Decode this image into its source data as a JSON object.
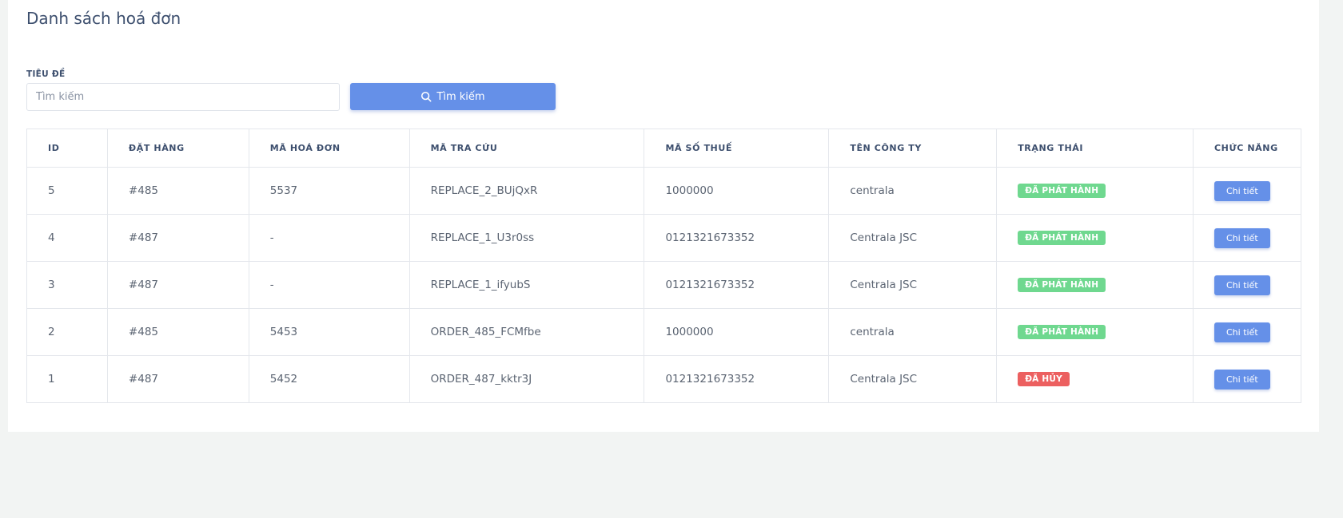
{
  "page": {
    "title": "Danh sách hoá đơn"
  },
  "search": {
    "label": "TIÊU ĐỀ",
    "placeholder": "Tìm kiếm",
    "value": "",
    "button_label": "Tìm kiếm"
  },
  "table": {
    "headers": [
      "ID",
      "ĐẶT HÀNG",
      "MÃ HOÁ ĐƠN",
      "MÃ TRA CỨU",
      "MÃ SỐ THUẾ",
      "TÊN CÔNG TY",
      "TRẠNG THÁI",
      "CHỨC NĂNG"
    ],
    "rows": [
      {
        "id": "5",
        "order": "#485",
        "invoice_no": "5537",
        "lookup_code": "REPLACE_2_BUjQxR",
        "tax_code": "1000000",
        "company": "centrala",
        "status": "ĐÃ PHÁT HÀNH",
        "status_type": "issued",
        "action": "Chi tiết"
      },
      {
        "id": "4",
        "order": "#487",
        "invoice_no": "-",
        "lookup_code": "REPLACE_1_U3r0ss",
        "tax_code": "0121321673352",
        "company": "Centrala JSC",
        "status": "ĐÃ PHÁT HÀNH",
        "status_type": "issued",
        "action": "Chi tiết"
      },
      {
        "id": "3",
        "order": "#487",
        "invoice_no": "-",
        "lookup_code": "REPLACE_1_ifyubS",
        "tax_code": "0121321673352",
        "company": "Centrala JSC",
        "status": "ĐÃ PHÁT HÀNH",
        "status_type": "issued",
        "action": "Chi tiết"
      },
      {
        "id": "2",
        "order": "#485",
        "invoice_no": "5453",
        "lookup_code": "ORDER_485_FCMfbe",
        "tax_code": "1000000",
        "company": "centrala",
        "status": "ĐÃ PHÁT HÀNH",
        "status_type": "issued",
        "action": "Chi tiết"
      },
      {
        "id": "1",
        "order": "#487",
        "invoice_no": "5452",
        "lookup_code": "ORDER_487_kktr3J",
        "tax_code": "0121321673352",
        "company": "Centrala JSC",
        "status": "ĐÃ HỦY",
        "status_type": "cancelled",
        "action": "Chi tiết"
      }
    ]
  },
  "colors": {
    "primary": "#6590e8",
    "issued": "#6fd88f",
    "cancelled": "#ec6060",
    "title": "#3d4f6e"
  }
}
